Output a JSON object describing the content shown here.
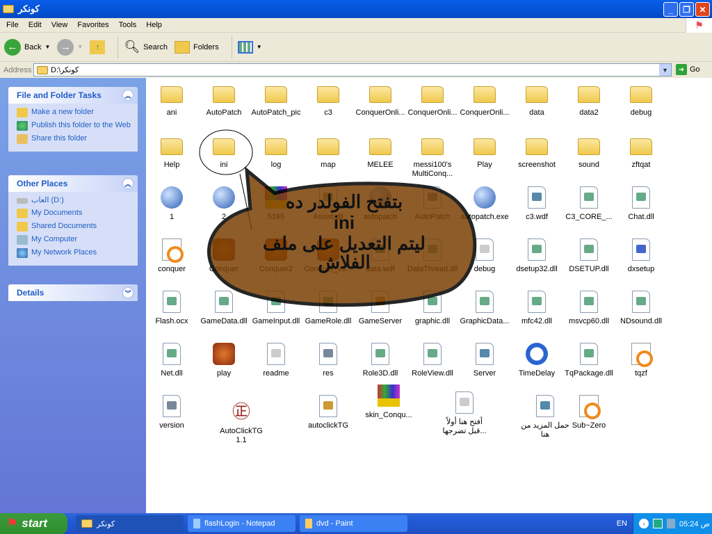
{
  "window": {
    "title": "كونكر"
  },
  "menu": [
    "File",
    "Edit",
    "View",
    "Favorites",
    "Tools",
    "Help"
  ],
  "toolbar": {
    "back": "Back",
    "search": "Search",
    "folders": "Folders"
  },
  "address": {
    "label": "Address",
    "value": "D:\\كونكر",
    "go": "Go"
  },
  "sidebar": {
    "tasks": {
      "title": "File and Folder Tasks",
      "items": [
        "Make a new folder",
        "Publish this folder to the Web",
        "Share this folder"
      ]
    },
    "places": {
      "title": "Other Places",
      "items": [
        "العاب (D:)",
        "My Documents",
        "Shared Documents",
        "My Computer",
        "My Network Places"
      ]
    },
    "details": {
      "title": "Details"
    }
  },
  "files": [
    {
      "name": "ani",
      "icon": "folder"
    },
    {
      "name": "AutoPatch",
      "icon": "folder"
    },
    {
      "name": "AutoPatch_pic",
      "icon": "folder"
    },
    {
      "name": "c3",
      "icon": "folder"
    },
    {
      "name": "ConquerOnli...",
      "icon": "folder"
    },
    {
      "name": "ConquerOnli...",
      "icon": "folder"
    },
    {
      "name": "ConquerOnli...",
      "icon": "folder"
    },
    {
      "name": "data",
      "icon": "folder"
    },
    {
      "name": "data2",
      "icon": "folder"
    },
    {
      "name": "debug",
      "icon": "folder"
    },
    {
      "name": "Help",
      "icon": "folder"
    },
    {
      "name": "ini",
      "icon": "folder"
    },
    {
      "name": "log",
      "icon": "folder"
    },
    {
      "name": "map",
      "icon": "folder"
    },
    {
      "name": "MELEE",
      "icon": "folder"
    },
    {
      "name": "messi100's MultiConq...",
      "icon": "folder"
    },
    {
      "name": "Play",
      "icon": "folder"
    },
    {
      "name": "screenshot",
      "icon": "folder"
    },
    {
      "name": "sound",
      "icon": "folder"
    },
    {
      "name": "zftqat",
      "icon": "folder"
    },
    {
      "name": "1",
      "icon": "ie-shortcut"
    },
    {
      "name": "2",
      "icon": "ie-shortcut"
    },
    {
      "name": "5165",
      "icon": "archive"
    },
    {
      "name": "Assist.dll",
      "icon": "dll"
    },
    {
      "name": "autopatch",
      "icon": "globe"
    },
    {
      "name": "AutoPatch",
      "icon": "media-file"
    },
    {
      "name": "autopatch.exe",
      "icon": "globe"
    },
    {
      "name": "c3.wdf",
      "icon": "app-file"
    },
    {
      "name": "C3_CORE_...",
      "icon": "dll"
    },
    {
      "name": "Chat.dll",
      "icon": "dll"
    },
    {
      "name": "conquer",
      "icon": "ico-file"
    },
    {
      "name": "Conquer",
      "icon": "game"
    },
    {
      "name": "Conquer2",
      "icon": "game"
    },
    {
      "name": "Conquer_v5...",
      "icon": "game"
    },
    {
      "name": "data.wdf",
      "icon": "app-file"
    },
    {
      "name": "DataThread.dll",
      "icon": "dll"
    },
    {
      "name": "debug",
      "icon": "text-file"
    },
    {
      "name": "dsetup32.dll",
      "icon": "dll"
    },
    {
      "name": "DSETUP.dll",
      "icon": "dll"
    },
    {
      "name": "dxsetup",
      "icon": "setup"
    },
    {
      "name": "Flash.ocx",
      "icon": "dll"
    },
    {
      "name": "GameData.dll",
      "icon": "dll"
    },
    {
      "name": "GameInput.dll",
      "icon": "dll"
    },
    {
      "name": "GameRole.dll",
      "icon": "dll"
    },
    {
      "name": "GameServer",
      "icon": "config"
    },
    {
      "name": "graphic.dll",
      "icon": "dll"
    },
    {
      "name": "GraphicData...",
      "icon": "dll"
    },
    {
      "name": "mfc42.dll",
      "icon": "dll"
    },
    {
      "name": "msvcp60.dll",
      "icon": "dll"
    },
    {
      "name": "NDsound.dll",
      "icon": "dll"
    },
    {
      "name": "Net.dll",
      "icon": "dll"
    },
    {
      "name": "play",
      "icon": "game"
    },
    {
      "name": "readme",
      "icon": "text-file"
    },
    {
      "name": "res",
      "icon": "media-file"
    },
    {
      "name": "Role3D.dll",
      "icon": "dll"
    },
    {
      "name": "RoleView.dll",
      "icon": "dll"
    },
    {
      "name": "Server",
      "icon": "app-file"
    },
    {
      "name": "TimeDelay",
      "icon": "clock"
    },
    {
      "name": "TqPackage.dll",
      "icon": "dll"
    },
    {
      "name": "tqzf",
      "icon": "ico-file"
    },
    {
      "name": "version",
      "icon": "media-file"
    },
    {
      "name": "AutoClickTG 1.1",
      "icon": "chinese-glyph"
    },
    {
      "name": "autoclickTG",
      "icon": "config"
    },
    {
      "name": "skin_Conqu...",
      "icon": "archive"
    },
    {
      "name": "أفتح هنا أولاً ...قبل تضرجها",
      "icon": "text-file"
    },
    {
      "name": "حمل المزيد من هنا",
      "icon": "app-shortcut"
    },
    {
      "name": "Sub~Zero",
      "icon": "ico-file"
    }
  ],
  "annotation": {
    "lines": [
      "بتفتح الفولدر ده",
      "ini",
      "ليتم التعديل على ملف",
      "الفلاش"
    ],
    "fill": "#7a4004"
  },
  "taskbar": {
    "start": "start",
    "tasks": [
      "كونكر",
      "flashLogin - Notepad",
      "dvd - Paint"
    ],
    "lang": "EN",
    "clock": "05:24 ص"
  }
}
